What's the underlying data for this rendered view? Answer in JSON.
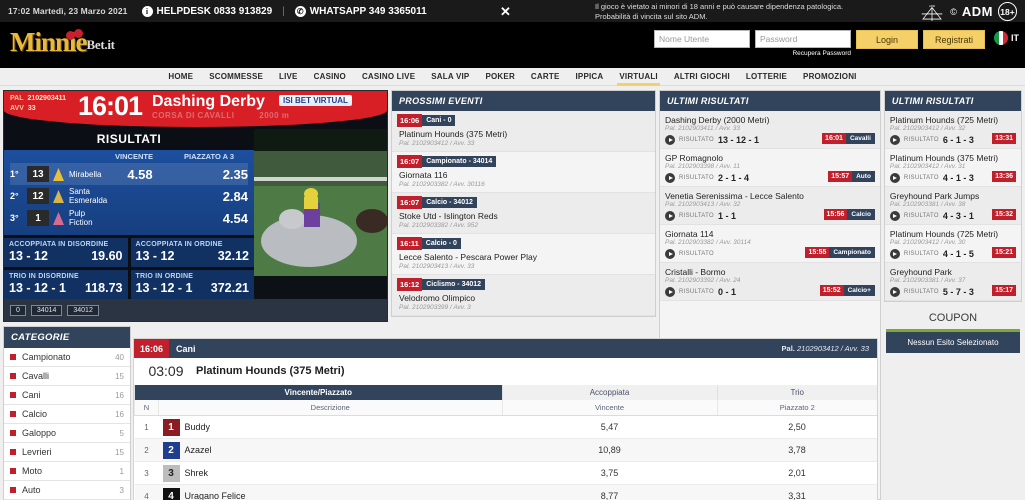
{
  "topbar": {
    "datetime": "17:02 Martedì, 23 Marzo 2021",
    "helpdesk_icon": "info-icon",
    "helpdesk": "HELPDESK 0833 913829",
    "separator": "|",
    "whatsapp_icon": "whatsapp-icon",
    "whatsapp": "WHATSAPP 349 3365011",
    "close_icon": "close-icon",
    "legal_line1": "Il gioco è vietato ai minori di 18 anni e può causare dipendenza patologica.",
    "legal_line2": "Probabilità di vincita sul sito ADM.",
    "adm_label": "ADM",
    "adm_age": "18+",
    "adm_copy": "©"
  },
  "header": {
    "logo_main": "Minnie",
    "logo_sub": "Bet.it",
    "username_placeholder": "Nome Utente",
    "password_placeholder": "Password",
    "recover_password": "Recupera Password",
    "login_label": "Login",
    "register_label": "Registrati",
    "lang": "IT",
    "keyboard_icon": "keyboard-icon",
    "flag_icon": "italy-flag-icon"
  },
  "nav": {
    "items": [
      {
        "label": "HOME",
        "active": false
      },
      {
        "label": "SCOMMESSE",
        "active": false
      },
      {
        "label": "LIVE",
        "active": false
      },
      {
        "label": "CASINO",
        "active": false
      },
      {
        "label": "CASINO LIVE",
        "active": false
      },
      {
        "label": "SALA VIP",
        "active": false
      },
      {
        "label": "POKER",
        "active": false
      },
      {
        "label": "CARTE",
        "active": false
      },
      {
        "label": "IPPICA",
        "active": false
      },
      {
        "label": "VIRTUALI",
        "active": true
      },
      {
        "label": "ALTRI GIOCHI",
        "active": false
      },
      {
        "label": "LOTTERIE",
        "active": false
      },
      {
        "label": "PROMOZIONI",
        "active": false
      }
    ]
  },
  "video": {
    "pal_label": "PAL",
    "pal_value": "2102903411",
    "avv_label": "AVV",
    "avv_value": "33",
    "clock": "16:01",
    "race_title": "Dashing Derby",
    "race_sub": "CORSA DI CAVALLI",
    "race_distance": "2000 m",
    "brand": "ISI BET VIRTUAL",
    "results_title": "RISULTATI",
    "col_vincente": "VINCENTE",
    "col_piazzato": "PIAZZATO A 3",
    "rows": [
      {
        "pos": "1°",
        "num": "13",
        "name": "Mirabella",
        "vincente": "4.58",
        "piazzato": "2.35",
        "silk": "#e8c03a"
      },
      {
        "pos": "2°",
        "num": "12",
        "name": "Santa Esmeralda",
        "vincente": "",
        "piazzato": "2.84",
        "silk": "#d8b44a"
      },
      {
        "pos": "3°",
        "num": "1",
        "name": "Pulp Fiction",
        "vincente": "",
        "piazzato": "4.54",
        "silk": "#d86a8e"
      }
    ],
    "quads": [
      {
        "title": "ACCOPPIATA IN DISORDINE",
        "combo": "13 - 12",
        "value": "19.60"
      },
      {
        "title": "ACCOPPIATA IN ORDINE",
        "combo": "13 - 12",
        "value": "32.12"
      },
      {
        "title": "TRIO IN DISORDINE",
        "combo": "13 - 12 - 1",
        "value": "118.73"
      },
      {
        "title": "TRIO IN ORDINE",
        "combo": "13 - 12 - 1",
        "value": "372.21"
      }
    ],
    "footer_tags": [
      "0",
      "34014",
      "34012"
    ]
  },
  "categorie": {
    "title": "CATEGORIE",
    "items": [
      {
        "label": "Campionato",
        "count": "40"
      },
      {
        "label": "Cavalli",
        "count": "15"
      },
      {
        "label": "Cani",
        "count": "16"
      },
      {
        "label": "Calcio",
        "count": "16"
      },
      {
        "label": "Galoppo",
        "count": "5"
      },
      {
        "label": "Levrieri",
        "count": "15"
      },
      {
        "label": "Moto",
        "count": "1"
      },
      {
        "label": "Auto",
        "count": "3"
      }
    ]
  },
  "prossimi_eventi": {
    "title": "PROSSIMI EVENTI",
    "events": [
      {
        "time": "16:06",
        "cat": "Cani - 0",
        "name": "Platinum Hounds (375 Metri)",
        "pal": "Pal. 2102903412 / Avv. 33"
      },
      {
        "time": "16:07",
        "cat": "Campionato - 34014",
        "name": "Giornata 116",
        "pal": "Pal. 2102903382 / Avv. 30116"
      },
      {
        "time": "16:07",
        "cat": "Calcio - 34012",
        "name": "Stoke Utd - Islington Reds",
        "pal": "Pal. 2102903382 / Avv. 952"
      },
      {
        "time": "16:11",
        "cat": "Calcio - 0",
        "name": "Lecce Salento - Pescara Power Play",
        "pal": "Pal. 2102903413 / Avv. 33"
      },
      {
        "time": "16:12",
        "cat": "Ciclismo - 34012",
        "name": "Velodromo Olimpico",
        "pal": "Pal. 2102903399 / Avv. 3"
      }
    ]
  },
  "ultimi_risultati_mid": {
    "title": "ULTIMI RISULTATI",
    "label_risultato": "RISULTATO",
    "events": [
      {
        "name": "Dashing Derby (2000 Metri)",
        "pal": "Pal. 2102903411 / Avv. 33",
        "result": "13 - 12 - 1",
        "time": "16:01",
        "cat": "Cavalli"
      },
      {
        "name": "GP Romagnolo",
        "pal": "Pal. 2102903398 / Avv. 11",
        "result": "2 - 1 - 4",
        "time": "15:57",
        "cat": "Auto"
      },
      {
        "name": "Venetia Serenissima - Lecce Salento",
        "pal": "Pal. 2102903413 / Avv. 32",
        "result": "1 - 1",
        "time": "15:56",
        "cat": "Calcio"
      },
      {
        "name": "Giornata 114",
        "pal": "Pal. 2102903382 / Avv. 30114",
        "result": "",
        "time": "15:55",
        "cat": "Campionato"
      },
      {
        "name": "Cristalli - Bormo",
        "pal": "Pal. 2102903392 / Avv. 24",
        "result": "0 - 1",
        "time": "15:52",
        "cat": "Calcio+"
      }
    ]
  },
  "ultimi_risultati_right": {
    "title": "ULTIMI RISULTATI",
    "label_risultato": "RISULTATO",
    "events": [
      {
        "name": "Platinum Hounds (725 Metri)",
        "pal": "Pal. 2102903412 / Avv. 32",
        "result": "6 - 1 - 3",
        "time": "13:31"
      },
      {
        "name": "Platinum Hounds (375 Metri)",
        "pal": "Pal. 2102903412 / Avv. 31",
        "result": "4 - 1 - 3",
        "time": "13:36"
      },
      {
        "name": "Greyhound Park Jumps",
        "pal": "Pal. 2102903381 / Avv. 38",
        "result": "4 - 3 - 1",
        "time": "15:32"
      },
      {
        "name": "Platinum Hounds (725 Metri)",
        "pal": "Pal. 2102903412 / Avv. 30",
        "result": "4 - 1 - 5",
        "time": "15:21"
      },
      {
        "name": "Greyhound Park",
        "pal": "Pal. 2102903381 / Avv. 37",
        "result": "5 - 7 - 3",
        "time": "15:17"
      }
    ]
  },
  "coupon": {
    "title": "COUPON",
    "empty_label": "Nessun Esito Selezionato"
  },
  "main": {
    "time": "16:06",
    "category": "Cani",
    "pal_label": "Pal.",
    "pal_value": "2102903412 / Avv. 33",
    "countdown": "03:09",
    "event_name": "Platinum Hounds (375 Metri)",
    "group_headers": [
      {
        "label": "Vincente/Piazzato",
        "selected": true
      },
      {
        "label": "Accoppiata",
        "selected": false
      },
      {
        "label": "Trio",
        "selected": false
      }
    ],
    "sub_headers": [
      "N",
      "Descrizione",
      "Vincente",
      "Piazzato 2"
    ],
    "rows": [
      {
        "n": "1",
        "num": "1",
        "name": "Buddy",
        "color": "#8c1c24",
        "textcolor": "#ffffff",
        "vincente": "5,47",
        "piazzato": "2,50"
      },
      {
        "n": "2",
        "num": "2",
        "name": "Azazel",
        "color": "#1e3f8f",
        "textcolor": "#ffffff",
        "vincente": "10,89",
        "piazzato": "3,78"
      },
      {
        "n": "3",
        "num": "3",
        "name": "Shrek",
        "color": "#bdbdbd",
        "textcolor": "#222222",
        "vincente": "3,75",
        "piazzato": "2,01"
      },
      {
        "n": "4",
        "num": "4",
        "name": "Uragano Felice",
        "color": "#111111",
        "textcolor": "#ffffff",
        "vincente": "8,77",
        "piazzato": "3,31"
      }
    ]
  },
  "colors": {
    "brand_yellow": "#f5cf67",
    "accent_red": "#c0202b",
    "panel_header": "#32435c",
    "coupon_green": "#7fa832"
  }
}
